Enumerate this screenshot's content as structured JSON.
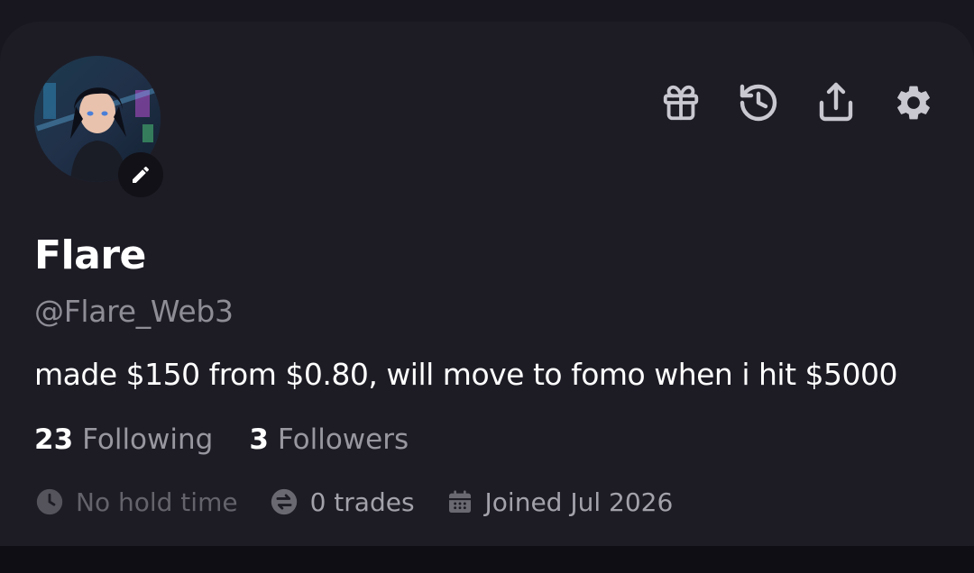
{
  "profile": {
    "display_name": "Flare",
    "handle": "@Flare_Web3",
    "bio": "made $150 from $0.80, will move to fomo when i hit $5000",
    "following_count": "23",
    "following_label": "Following",
    "followers_count": "3",
    "followers_label": "Followers"
  },
  "stats": {
    "hold_time": "No hold time",
    "trades": "0 trades",
    "joined": "Joined Jul 2026"
  },
  "toolbar": {
    "icons": [
      "gift-icon",
      "history-icon",
      "share-icon",
      "settings-icon"
    ]
  },
  "colors": {
    "background": "#18171f",
    "card": "#1d1c25",
    "muted_text": "#8e8d96",
    "icon": "#c9c8d0"
  }
}
